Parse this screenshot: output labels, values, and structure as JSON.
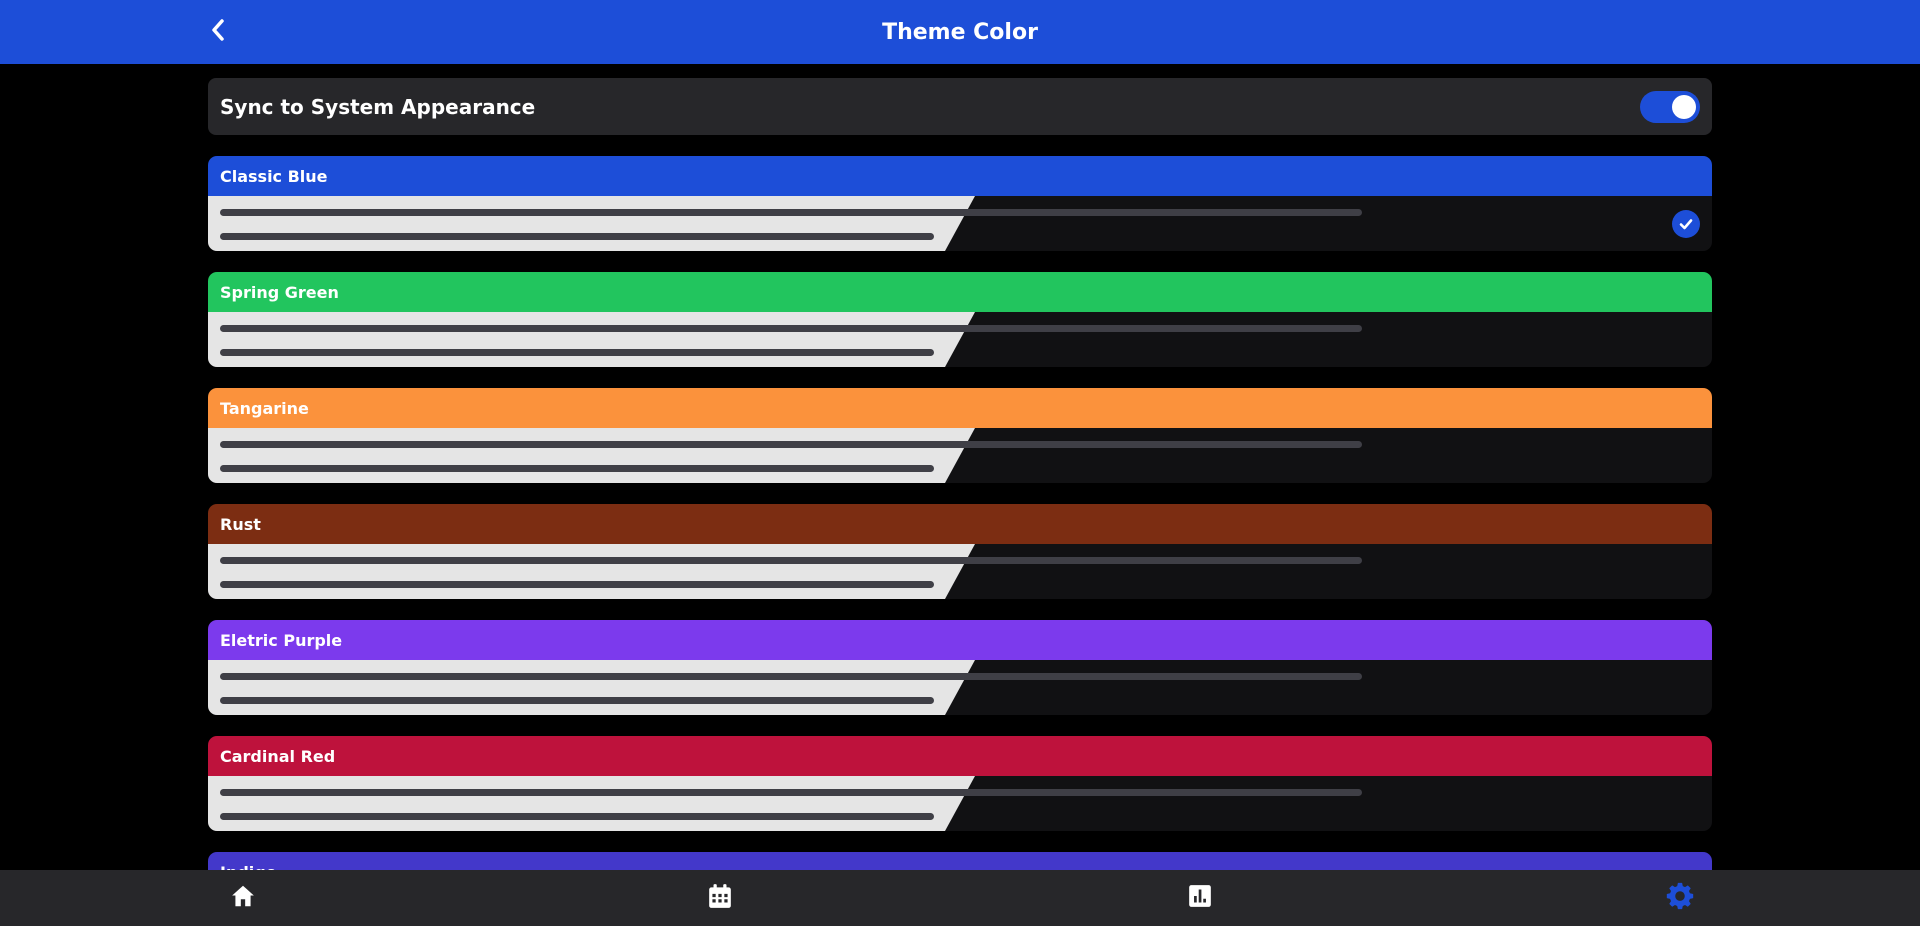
{
  "header": {
    "title": "Theme Color",
    "back_icon": "chevron-left-icon",
    "background": "#1d4ed8"
  },
  "sync": {
    "label": "Sync to System Appearance",
    "enabled": true,
    "toggle_color": "#1d4ed8"
  },
  "themes": [
    {
      "name": "Classic Blue",
      "color": "#1d4ed8",
      "selected": true
    },
    {
      "name": "Spring Green",
      "color": "#22c55e",
      "selected": false
    },
    {
      "name": "Tangarine",
      "color": "#fb923c",
      "selected": false
    },
    {
      "name": "Rust",
      "color": "#7c2d12",
      "selected": false
    },
    {
      "name": "Eletric Purple",
      "color": "#7c3aed",
      "selected": false
    },
    {
      "name": "Cardinal Red",
      "color": "#be123c",
      "selected": false
    },
    {
      "name": "Indigo",
      "color": "#4338ca",
      "selected": false
    }
  ],
  "bottom_nav": {
    "items": [
      {
        "icon": "home-icon",
        "active": false
      },
      {
        "icon": "calendar-icon",
        "active": false
      },
      {
        "icon": "chart-icon",
        "active": false
      },
      {
        "icon": "gear-icon",
        "active": true
      }
    ],
    "active_color": "#1d4ed8",
    "inactive_color": "#ffffff"
  }
}
